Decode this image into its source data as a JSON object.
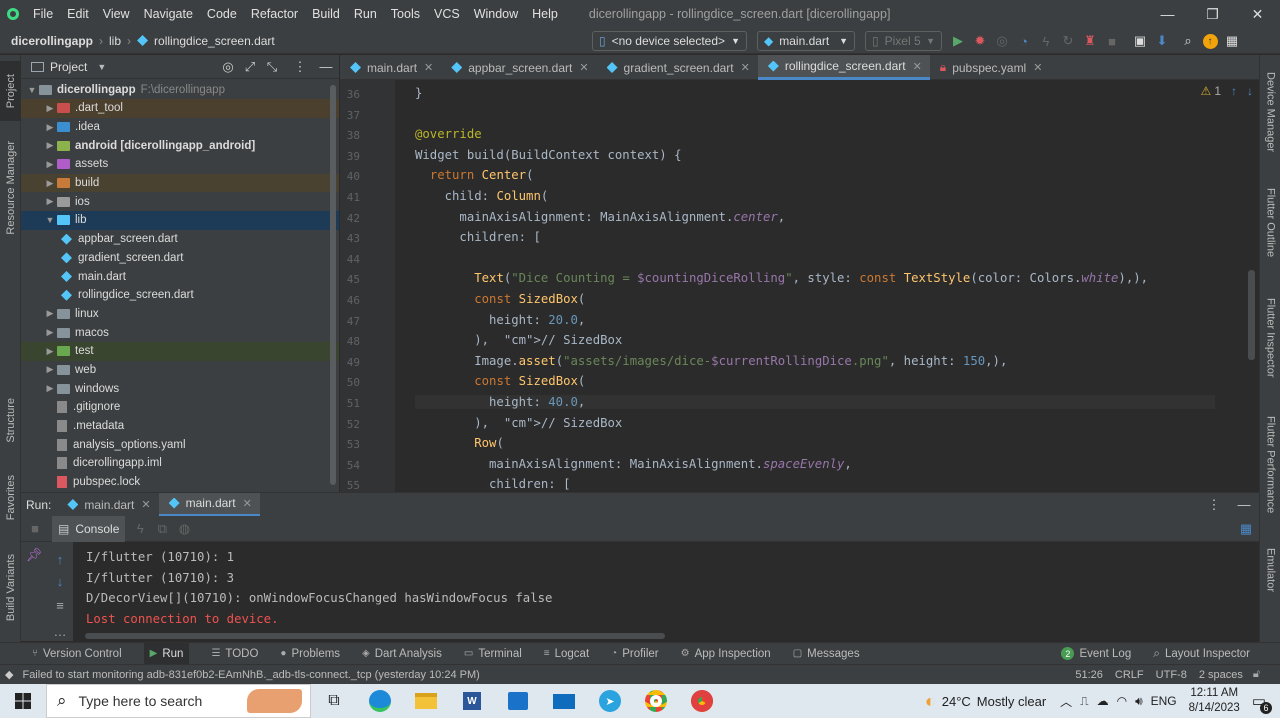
{
  "menu": [
    "File",
    "Edit",
    "View",
    "Navigate",
    "Code",
    "Refactor",
    "Build",
    "Run",
    "Tools",
    "VCS",
    "Window",
    "Help"
  ],
  "window_title": "dicerollingapp - rollingdice_screen.dart [dicerollingapp]",
  "breadcrumb": {
    "project": "dicerollingapp",
    "folder": "lib",
    "file": "rollingdice_screen.dart"
  },
  "toolbar": {
    "device": "<no device selected>",
    "config": "main.dart",
    "emulator": "Pixel 5"
  },
  "project_panel": {
    "title": "Project",
    "root_name": "dicerollingapp",
    "root_path": "F:\\dicerollingapp",
    "items": [
      {
        "name": ".dart_tool",
        "kind": "folder"
      },
      {
        "name": ".idea",
        "kind": "folder"
      },
      {
        "name": "android [dicerollingapp_android]",
        "kind": "folder"
      },
      {
        "name": "assets",
        "kind": "folder"
      },
      {
        "name": "build",
        "kind": "folder"
      },
      {
        "name": "ios",
        "kind": "folder"
      },
      {
        "name": "lib",
        "kind": "folder-open"
      },
      {
        "name": "appbar_screen.dart",
        "kind": "dart"
      },
      {
        "name": "gradient_screen.dart",
        "kind": "dart"
      },
      {
        "name": "main.dart",
        "kind": "dart"
      },
      {
        "name": "rollingdice_screen.dart",
        "kind": "dart"
      },
      {
        "name": "linux",
        "kind": "folder"
      },
      {
        "name": "macos",
        "kind": "folder"
      },
      {
        "name": "test",
        "kind": "folder"
      },
      {
        "name": "web",
        "kind": "folder"
      },
      {
        "name": "windows",
        "kind": "folder"
      },
      {
        "name": ".gitignore",
        "kind": "file"
      },
      {
        "name": ".metadata",
        "kind": "file"
      },
      {
        "name": "analysis_options.yaml",
        "kind": "file"
      },
      {
        "name": "dicerollingapp.iml",
        "kind": "file"
      },
      {
        "name": "pubspec.lock",
        "kind": "file"
      }
    ]
  },
  "editor_tabs": [
    "main.dart",
    "appbar_screen.dart",
    "gradient_screen.dart",
    "rollingdice_screen.dart",
    "pubspec.yaml"
  ],
  "inspection": {
    "warnings": "1"
  },
  "code_lines": [
    {
      "n": "36",
      "t": "}"
    },
    {
      "n": "37",
      "t": ""
    },
    {
      "n": "38",
      "t": "@override"
    },
    {
      "n": "39",
      "t": "Widget build(BuildContext context) {"
    },
    {
      "n": "40",
      "t": "  return Center("
    },
    {
      "n": "41",
      "t": "    child: Column("
    },
    {
      "n": "42",
      "t": "      mainAxisAlignment: MainAxisAlignment.center,"
    },
    {
      "n": "43",
      "t": "      children: ["
    },
    {
      "n": "44",
      "t": ""
    },
    {
      "n": "45",
      "t": "        Text(\"Dice Counting = $countingDiceRolling\", style: const TextStyle(color: Colors.white),),"
    },
    {
      "n": "46",
      "t": "        const SizedBox("
    },
    {
      "n": "47",
      "t": "          height: 20.0,"
    },
    {
      "n": "48",
      "t": "        ),  // SizedBox"
    },
    {
      "n": "49",
      "t": "        Image.asset(\"assets/images/dice-$currentRollingDice.png\", height: 150,),"
    },
    {
      "n": "50",
      "t": "        const SizedBox("
    },
    {
      "n": "51",
      "t": "          height: 40.0,"
    },
    {
      "n": "52",
      "t": "        ),  // SizedBox"
    },
    {
      "n": "53",
      "t": "        Row("
    },
    {
      "n": "54",
      "t": "          mainAxisAlignment: MainAxisAlignment.spaceEvenly,"
    },
    {
      "n": "55",
      "t": "          children: ["
    }
  ],
  "run_panel": {
    "label": "Run:",
    "tabs": [
      "main.dart",
      "main.dart"
    ],
    "console_tab": "Console"
  },
  "console_lines": [
    {
      "t": "I/flutter (10710): 1",
      "err": false
    },
    {
      "t": "I/flutter (10710): 3",
      "err": false
    },
    {
      "t": "D/DecorView[](10710): onWindowFocusChanged hasWindowFocus false",
      "err": false
    },
    {
      "t": "Lost connection to device.",
      "err": true
    }
  ],
  "bottom_tools": [
    "Version Control",
    "Run",
    "TODO",
    "Problems",
    "Dart Analysis",
    "Terminal",
    "Logcat",
    "Profiler",
    "App Inspection",
    "Messages"
  ],
  "bottom_right_tools": {
    "event_log": "Event Log",
    "event_count": "2",
    "layout_inspector": "Layout Inspector"
  },
  "status": {
    "message": "Failed to start monitoring adb-831ef0b2-EAmNhB._adb-tls-connect._tcp (yesterday 10:24 PM)",
    "position": "51:26",
    "line_sep": "CRLF",
    "encoding": "UTF-8",
    "indent": "2 spaces"
  },
  "left_strip": [
    "Project",
    "Resource Manager",
    "Structure",
    "Favorites",
    "Build Variants"
  ],
  "right_strip": [
    "Device Manager",
    "Flutter Outline",
    "Flutter Inspector",
    "Flutter Performance",
    "Emulator"
  ],
  "taskbar": {
    "search_placeholder": "Type here to search",
    "weather_temp": "24°C",
    "weather_text": "Mostly clear",
    "lang": "ENG",
    "time": "12:11 AM",
    "date": "8/14/2023",
    "notif": "6"
  }
}
